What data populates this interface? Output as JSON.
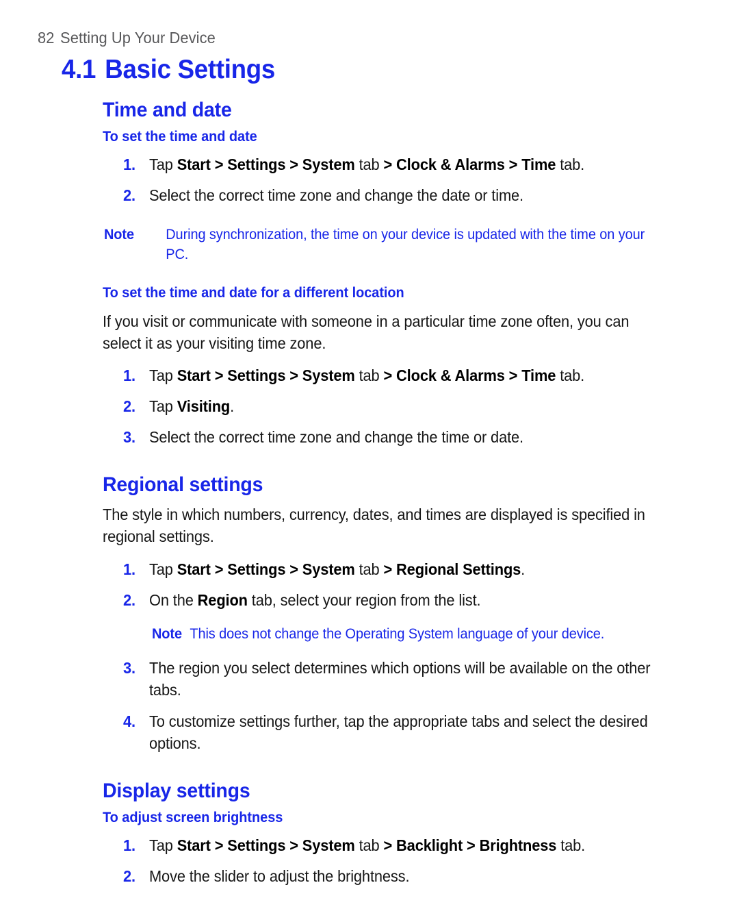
{
  "page": {
    "number": "82",
    "running_header": "Setting Up Your Device",
    "accent_color": "#1826e8",
    "header_color": "#58585a",
    "body_color": "#161616"
  },
  "chapter": {
    "number": "4.1",
    "title": "Basic Settings"
  },
  "sections": {
    "time_and_date": {
      "heading": "Time and date",
      "sub_one": {
        "heading": "To set the time and date",
        "steps": [
          {
            "marker": "1.",
            "parts": [
              {
                "text": "Tap ",
                "bold": false
              },
              {
                "text": "Start > Settings > System",
                "bold": true
              },
              {
                "text": " tab ",
                "bold": false
              },
              {
                "text": "> Clock & Alarms > Time",
                "bold": true
              },
              {
                "text": " tab.",
                "bold": false
              }
            ]
          },
          {
            "marker": "2.",
            "parts": [
              {
                "text": "Select the correct time zone and change the date or time.",
                "bold": false
              }
            ]
          }
        ]
      },
      "note": {
        "label": "Note",
        "text": "During synchronization, the time on your device is updated with the time on your PC."
      },
      "sub_two": {
        "heading": "To set the time and date for a different location",
        "intro": "If you visit or communicate with someone in a particular time zone often, you can select it as your visiting time zone.",
        "steps": [
          {
            "marker": "1.",
            "parts": [
              {
                "text": "Tap ",
                "bold": false
              },
              {
                "text": "Start > Settings > System",
                "bold": true
              },
              {
                "text": " tab ",
                "bold": false
              },
              {
                "text": "> Clock & Alarms > Time",
                "bold": true
              },
              {
                "text": " tab.",
                "bold": false
              }
            ]
          },
          {
            "marker": "2.",
            "parts": [
              {
                "text": "Tap ",
                "bold": false
              },
              {
                "text": "Visiting",
                "bold": true
              },
              {
                "text": ".",
                "bold": false
              }
            ]
          },
          {
            "marker": "3.",
            "parts": [
              {
                "text": "Select the correct time zone and change the time or date.",
                "bold": false
              }
            ]
          }
        ]
      }
    },
    "regional_settings": {
      "heading": "Regional settings",
      "intro": "The style in which numbers, currency, dates, and times are displayed is specified in regional settings.",
      "steps_first": [
        {
          "marker": "1.",
          "parts": [
            {
              "text": "Tap ",
              "bold": false
            },
            {
              "text": "Start > Settings > System",
              "bold": true
            },
            {
              "text": " tab ",
              "bold": false
            },
            {
              "text": "> Regional Settings",
              "bold": true
            },
            {
              "text": ".",
              "bold": false
            }
          ]
        },
        {
          "marker": "2.",
          "parts": [
            {
              "text": "On the ",
              "bold": false
            },
            {
              "text": "Region",
              "bold": true
            },
            {
              "text": " tab, select your region from the list.",
              "bold": false
            }
          ]
        }
      ],
      "note": {
        "label": "Note",
        "text": "This does not change the Operating System language of your device."
      },
      "steps_second": [
        {
          "marker": "3.",
          "parts": [
            {
              "text": "The region you select determines which options will be available on the other tabs.",
              "bold": false
            }
          ]
        },
        {
          "marker": "4.",
          "parts": [
            {
              "text": "To customize settings further, tap the appropriate tabs and select the desired options.",
              "bold": false
            }
          ]
        }
      ]
    },
    "display_settings": {
      "heading": "Display settings",
      "sub_one": {
        "heading": "To adjust screen brightness",
        "steps": [
          {
            "marker": "1.",
            "parts": [
              {
                "text": "Tap ",
                "bold": false
              },
              {
                "text": "Start > Settings > System",
                "bold": true
              },
              {
                "text": " tab ",
                "bold": false
              },
              {
                "text": "> Backlight > Brightness",
                "bold": true
              },
              {
                "text": " tab.",
                "bold": false
              }
            ]
          },
          {
            "marker": "2.",
            "parts": [
              {
                "text": "Move the slider to adjust the brightness.",
                "bold": false
              }
            ]
          }
        ]
      }
    }
  }
}
